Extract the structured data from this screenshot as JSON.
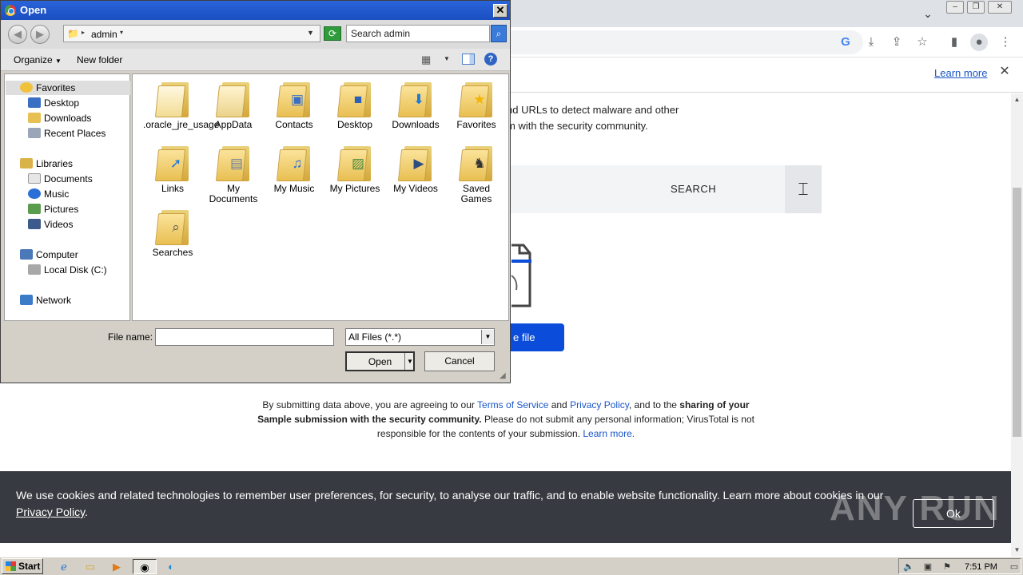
{
  "browser": {
    "learn_more": "Learn more",
    "intro_line1": "nd URLs to detect malware and other",
    "intro_line2": "m with the security community.",
    "search_label": "SEARCH",
    "choose_file_partial": "e file",
    "terms": {
      "p1": "By submitting data above, you are agreeing to our ",
      "tos": "Terms of Service",
      "and": " and ",
      "privacy": "Privacy Policy",
      "p2": ", and to the ",
      "bold1": "sharing of your Sample submission with the security community.",
      "p3": " Please do not submit any personal information; VirusTotal is not responsible for the contents of your submission. ",
      "learn": "Learn more."
    },
    "cookie": {
      "text": "We use cookies and related technologies to remember user preferences, for security, to analyse our traffic, and to enable website functionality. Learn more about cookies in our ",
      "link": "Privacy Policy",
      "tail": ".",
      "ok": "Ok"
    },
    "watermark": "ANY RUN"
  },
  "dialog": {
    "title": "Open",
    "close_glyph": "✕",
    "address": "admin",
    "search_placeholder": "Search admin",
    "organize": "Organize",
    "new_folder": "New folder",
    "nav": {
      "favorites": "Favorites",
      "desktop": "Desktop",
      "downloads": "Downloads",
      "recent_places": "Recent Places",
      "libraries": "Libraries",
      "documents": "Documents",
      "music": "Music",
      "pictures": "Pictures",
      "videos": "Videos",
      "computer": "Computer",
      "local_disk": "Local Disk (C:)",
      "network": "Network"
    },
    "files": [
      {
        "label": ".oracle_jre_usage",
        "icon": "folder-icon"
      },
      {
        "label": "AppData",
        "icon": "folder-icon"
      },
      {
        "label": "Contacts",
        "icon": "contacts-folder-icon"
      },
      {
        "label": "Desktop",
        "icon": "desktop-folder-icon"
      },
      {
        "label": "Downloads",
        "icon": "downloads-folder-icon"
      },
      {
        "label": "Favorites",
        "icon": "favorites-folder-icon"
      },
      {
        "label": "Links",
        "icon": "links-folder-icon"
      },
      {
        "label": "My Documents",
        "icon": "documents-folder-icon"
      },
      {
        "label": "My Music",
        "icon": "music-folder-icon"
      },
      {
        "label": "My Pictures",
        "icon": "pictures-folder-icon"
      },
      {
        "label": "My Videos",
        "icon": "videos-folder-icon"
      },
      {
        "label": "Saved Games",
        "icon": "games-folder-icon"
      },
      {
        "label": "Searches",
        "icon": "searches-folder-icon"
      }
    ],
    "file_name_label": "File name:",
    "file_name_value": "",
    "filter": "All Files (*.*)",
    "open_btn": "Open",
    "cancel_btn": "Cancel"
  },
  "taskbar": {
    "start": "Start",
    "clock": "7:51 PM"
  }
}
